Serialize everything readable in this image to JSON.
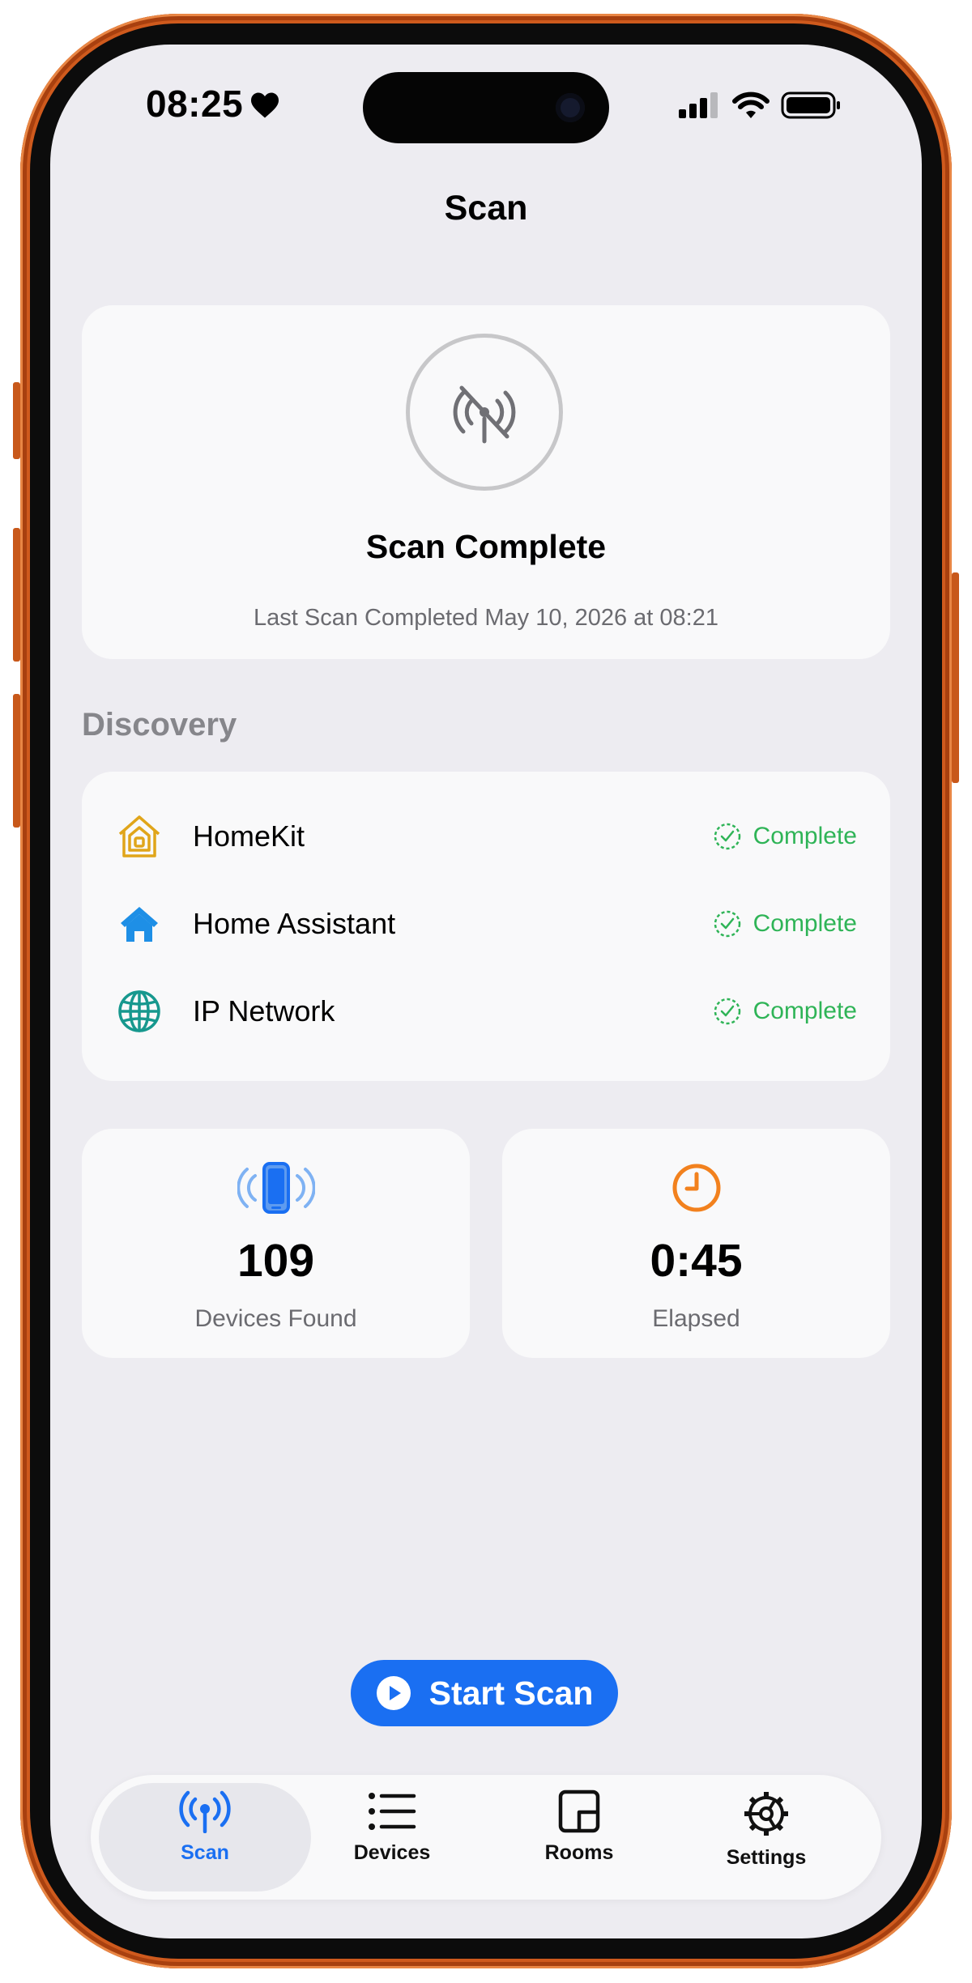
{
  "status_bar": {
    "time": "08:25"
  },
  "nav": {
    "title": "Scan"
  },
  "scan_status": {
    "title": "Scan Complete",
    "subtitle": "Last Scan Completed May 10, 2026 at 08:21",
    "icon": "antenna-slash-icon"
  },
  "discovery": {
    "header": "Discovery",
    "items": [
      {
        "label": "HomeKit",
        "status": "Complete",
        "icon": "homekit-house-icon",
        "icon_color": "#e0a51a"
      },
      {
        "label": "Home Assistant",
        "status": "Complete",
        "icon": "house-fill-icon",
        "icon_color": "#1e8fe6"
      },
      {
        "label": "IP Network",
        "status": "Complete",
        "icon": "globe-icon",
        "icon_color": "#17988e"
      }
    ]
  },
  "stats": {
    "devices": {
      "value": "109",
      "label": "Devices Found",
      "icon": "phone-radiowaves-icon",
      "icon_color": "#1a6ff2"
    },
    "elapsed": {
      "value": "0:45",
      "label": "Elapsed",
      "icon": "clock-icon",
      "icon_color": "#f2811e"
    }
  },
  "actions": {
    "start_scan": "Start Scan"
  },
  "tabs": [
    {
      "label": "Scan",
      "icon": "antenna-icon",
      "active": true
    },
    {
      "label": "Devices",
      "icon": "list-icon",
      "active": false
    },
    {
      "label": "Rooms",
      "icon": "rooms-icon",
      "active": false
    },
    {
      "label": "Settings",
      "icon": "gear-icon",
      "active": false
    }
  ],
  "colors": {
    "accent": "#1a6ff2",
    "success": "#2fb457",
    "frame": "#cf5a1d"
  }
}
